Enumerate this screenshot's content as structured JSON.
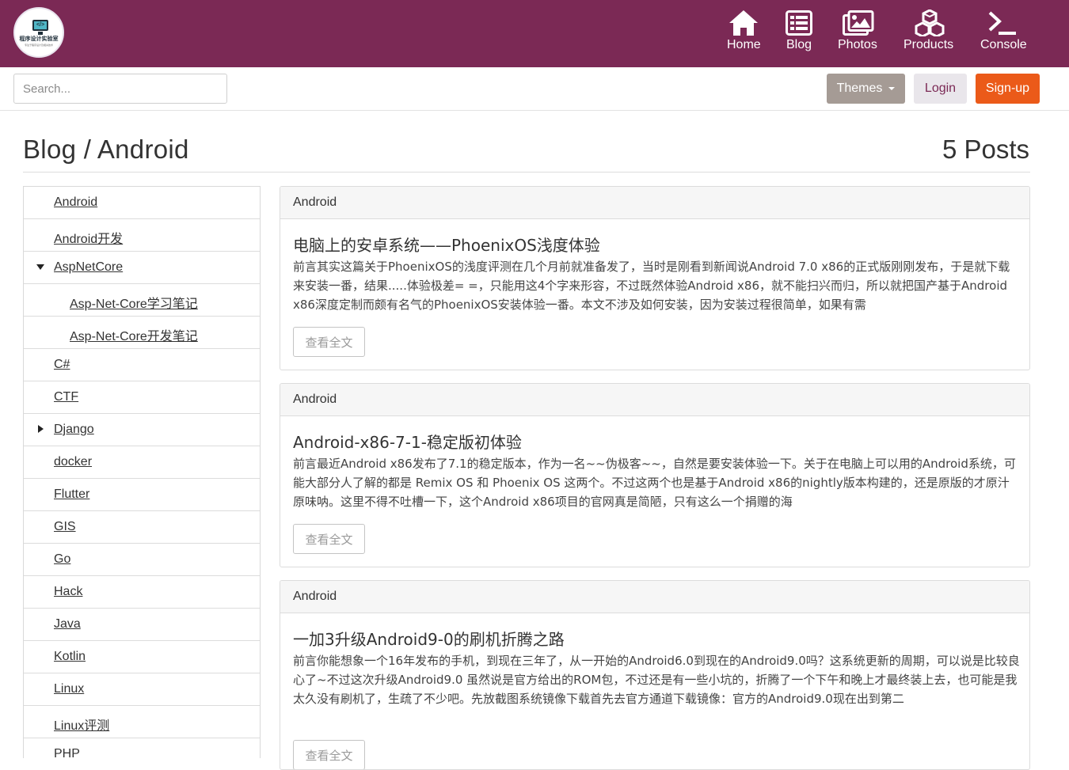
{
  "header": {
    "logo_title": "程序设计实验室",
    "logo_subtitle": "专注于程序设计及相关技术",
    "nav": [
      {
        "label": "Home",
        "icon": "home-icon"
      },
      {
        "label": "Blog",
        "icon": "list-icon"
      },
      {
        "label": "Photos",
        "icon": "photos-icon"
      },
      {
        "label": "Products",
        "icon": "cubes-icon"
      },
      {
        "label": "Console",
        "icon": "terminal-icon"
      }
    ],
    "background": "#7b2955"
  },
  "toolbar": {
    "search_placeholder": "Search...",
    "themes_label": "Themes",
    "login_label": "Login",
    "signup_label": "Sign-up"
  },
  "page": {
    "title": "Blog / Android",
    "post_count": "5 Posts"
  },
  "sidebar": {
    "items": [
      {
        "label": "Android"
      },
      {
        "label": "Android开发"
      },
      {
        "label": "AspNetCore",
        "toggle": "expanded"
      },
      {
        "label": "Asp-Net-Core学习笔记",
        "child": true
      },
      {
        "label": "Asp-Net-Core开发笔记",
        "child": true
      },
      {
        "label": "C#"
      },
      {
        "label": "CTF"
      },
      {
        "label": "Django",
        "toggle": "collapsed"
      },
      {
        "label": "docker"
      },
      {
        "label": "Flutter"
      },
      {
        "label": "GIS"
      },
      {
        "label": "Go"
      },
      {
        "label": "Hack"
      },
      {
        "label": "Java"
      },
      {
        "label": "Kotlin"
      },
      {
        "label": "Linux"
      },
      {
        "label": "Linux评测"
      },
      {
        "label": "PHP"
      }
    ]
  },
  "posts": [
    {
      "category": "Android",
      "title": "电脑上的安卓系统——PhoenixOS浅度体验",
      "excerpt": "前言其实这篇关于PhoenixOS的浅度评测在几个月前就准备发了，当时是刚看到新闻说Android 7.0 x86的正式版刚刚发布，于是就下载来安装一番，结果.....体验极差= =，只能用这4个字来形容，不过既然体验Android x86，就不能扫兴而归，所以就把国产基于Android x86深度定制而颇有名气的PhoenixOS安装体验一番。本文不涉及如何安装，因为安装过程很简单，如果有需",
      "button": "查看全文"
    },
    {
      "category": "Android",
      "title": "Android-x86-7-1-稳定版初体验",
      "excerpt": "前言最近Android x86发布了7.1的稳定版本，作为一名~~伪极客~~，自然是要安装体验一下。关于在电脑上可以用的Android系统，可能大部分人了解的都是 Remix OS 和 Phoenix OS 这两个。不过这两个也是基于Android x86的nightly版本构建的，还是原版的才原汁原味呐。这里不得不吐槽一下，这个Android x86项目的官网真是简陋，只有这么一个捐赠的海",
      "button": "查看全文"
    },
    {
      "category": "Android",
      "title": "一加3升级Android9-0的刷机折腾之路",
      "excerpt": "前言你能想象一个16年发布的手机，到现在三年了，从一开始的Android6.0到现在的Android9.0吗？这系统更新的周期，可以说是比较良心了~不过这次升级Android9.0 虽然说是官方给出的ROM包，不过还是有一些小坑的，折腾了一个下午和晚上才最终装上去，也可能是我太久没有刷机了，生疏了不少吧。先放截图系统镜像下载首先去官方通道下载镜像：官方的Android9.0现在出到第二",
      "button": "查看全文"
    }
  ],
  "colors": {
    "brand": "#7b2955",
    "themes_button": "#a59b95",
    "login_button": "#e9e6eb",
    "signup_button": "#eb5a19"
  }
}
